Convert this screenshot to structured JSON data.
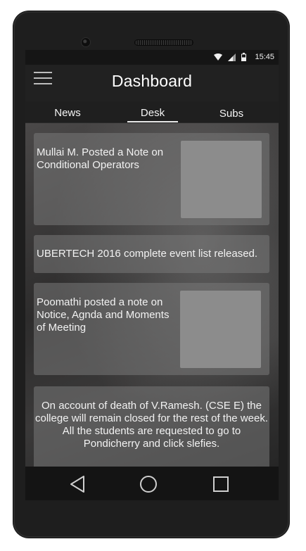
{
  "status_bar": {
    "time": "15:45",
    "icons": [
      "wifi-icon",
      "signal-icon",
      "battery-icon"
    ]
  },
  "app_bar": {
    "title": "Dashboard",
    "menu_icon": "hamburger-menu-icon"
  },
  "tabs": [
    {
      "label": "News",
      "selected": false
    },
    {
      "label": "Desk",
      "selected": true
    },
    {
      "label": "Subs",
      "selected": false
    }
  ],
  "feed": [
    {
      "text": "Mullai M. Posted a Note on Conditional Operators",
      "has_thumbnail": true
    },
    {
      "text": "UBERTECH 2016 complete event list released.",
      "has_thumbnail": false
    },
    {
      "text": "Poomathi posted a note on Notice, Agnda and Moments of Meeting",
      "has_thumbnail": true
    },
    {
      "text": "On account of death of V.Ramesh. (CSE E) the college will remain closed for the rest of the week. All the students are requested to go to Pondicherry and click slefies.",
      "has_thumbnail": false
    }
  ],
  "nav_bar": {
    "buttons": [
      "back-icon",
      "home-icon",
      "recents-icon"
    ]
  },
  "colors": {
    "background": "#1b1b1b",
    "card": "#787878",
    "thumbnail": "#8c8c8c",
    "text": "#f2f2f2"
  }
}
